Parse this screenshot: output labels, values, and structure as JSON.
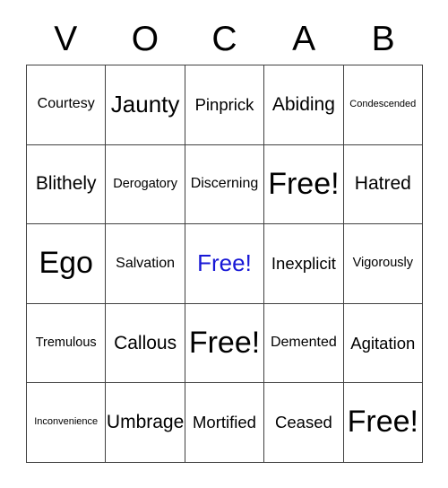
{
  "card": {
    "title_letters": [
      "V",
      "O",
      "C",
      "A",
      "B"
    ],
    "free_label": "Free!",
    "colors": {
      "text": "#000000",
      "free_highlight": "#1717d6",
      "grid_line": "#404040",
      "background": "#ffffff"
    },
    "grid": {
      "columns": 5,
      "rows": 5,
      "cells": [
        [
          {
            "text": "Courtesy",
            "size": "s",
            "free": false,
            "color": "#000000"
          },
          {
            "text": "Jaunty",
            "size": "xl",
            "free": false,
            "color": "#000000"
          },
          {
            "text": "Pinprick",
            "size": "m",
            "free": false,
            "color": "#000000"
          },
          {
            "text": "Abiding",
            "size": "l",
            "free": false,
            "color": "#000000"
          },
          {
            "text": "Condescended",
            "size": "xxs",
            "free": false,
            "color": "#000000"
          }
        ],
        [
          {
            "text": "Blithely",
            "size": "l",
            "free": false,
            "color": "#000000"
          },
          {
            "text": "Derogatory",
            "size": "xs",
            "free": false,
            "color": "#000000"
          },
          {
            "text": "Discerning",
            "size": "s",
            "free": false,
            "color": "#000000"
          },
          {
            "text": "Free!",
            "size": "xxl",
            "free": true,
            "color": "#000000"
          },
          {
            "text": "Hatred",
            "size": "l",
            "free": false,
            "color": "#000000"
          }
        ],
        [
          {
            "text": "Ego",
            "size": "xxl",
            "free": false,
            "color": "#000000"
          },
          {
            "text": "Salvation",
            "size": "s",
            "free": false,
            "color": "#000000"
          },
          {
            "text": "Free!",
            "size": "xl",
            "free": true,
            "color": "#1717d6"
          },
          {
            "text": "Inexplicit",
            "size": "m",
            "free": false,
            "color": "#000000"
          },
          {
            "text": "Vigorously",
            "size": "xs",
            "free": false,
            "color": "#000000"
          }
        ],
        [
          {
            "text": "Tremulous",
            "size": "xs",
            "free": false,
            "color": "#000000"
          },
          {
            "text": "Callous",
            "size": "l",
            "free": false,
            "color": "#000000"
          },
          {
            "text": "Free!",
            "size": "xxl",
            "free": true,
            "color": "#000000"
          },
          {
            "text": "Demented",
            "size": "s",
            "free": false,
            "color": "#000000"
          },
          {
            "text": "Agitation",
            "size": "m",
            "free": false,
            "color": "#000000"
          }
        ],
        [
          {
            "text": "Inconvenience",
            "size": "xxs",
            "free": false,
            "color": "#000000"
          },
          {
            "text": "Umbrage",
            "size": "l",
            "free": false,
            "color": "#000000"
          },
          {
            "text": "Mortified",
            "size": "m",
            "free": false,
            "color": "#000000"
          },
          {
            "text": "Ceased",
            "size": "m",
            "free": false,
            "color": "#000000"
          },
          {
            "text": "Free!",
            "size": "xxl",
            "free": true,
            "color": "#000000"
          }
        ]
      ]
    }
  }
}
